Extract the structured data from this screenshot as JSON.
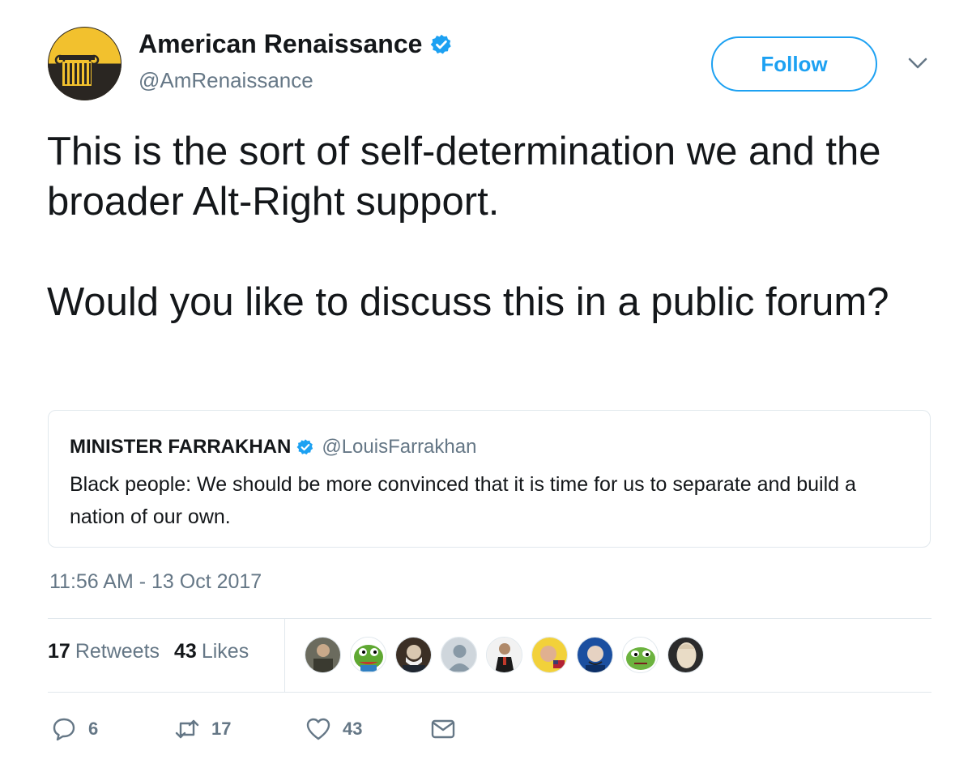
{
  "author": {
    "display_name": "American Renaissance",
    "handle": "@AmRenaissance",
    "verified_icon": "verified-badge-icon",
    "avatar_icon": "column-logo-icon"
  },
  "follow_label": "Follow",
  "menu_icon": "chevron-down-icon",
  "tweet": {
    "paragraph_1": "This is the sort of self-determination we and the broader Alt-Right support.",
    "paragraph_2": "Would you like to discuss this in a public forum?"
  },
  "quoted_tweet": {
    "display_name": "MINISTER FARRAKHAN",
    "handle": "@LouisFarrakhan",
    "text": "Black people: We should be more convinced that it is time for us to separate and build a nation of our own."
  },
  "timestamp": "11:56 AM - 13 Oct 2017",
  "stats": {
    "retweets_count": "17",
    "retweets_label": "Retweets",
    "likes_count": "43",
    "likes_label": "Likes"
  },
  "actions": {
    "reply_count": "6",
    "retweet_count": "17",
    "like_count": "43"
  },
  "colors": {
    "accent": "#1da1f2",
    "secondary_text": "#657786",
    "border": "#e1e8ed"
  }
}
